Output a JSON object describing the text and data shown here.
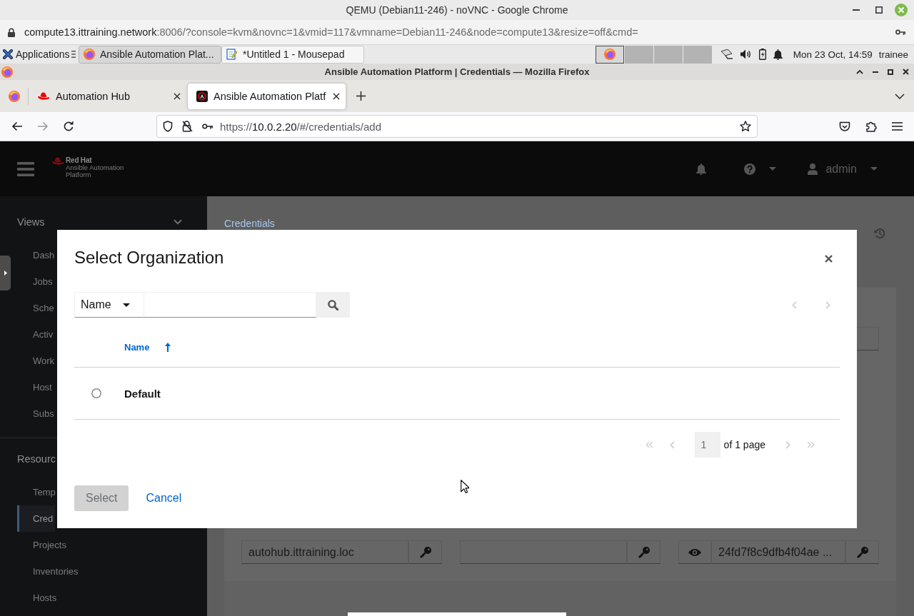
{
  "chrome": {
    "title": "QEMU (Debian11-246) - noVNC - Google Chrome",
    "url_host": "compute13.ittraining.network",
    "url_rest": ":8006/?console=kvm&novnc=1&vmid=117&vmname=Debian11-246&node=compute13&resize=off&cmd="
  },
  "panel": {
    "menu": "Applications",
    "tasks": [
      {
        "label": "Ansible Automation Plat...",
        "kind": "browser",
        "selected": true
      },
      {
        "label": "*Untitled 1 - Mousepad",
        "kind": "editor",
        "selected": false
      }
    ],
    "workspaces": [
      {
        "kind": "browser",
        "selected": true
      },
      {
        "kind": "empty",
        "selected": false
      },
      {
        "kind": "empty",
        "selected": false
      },
      {
        "kind": "empty",
        "selected": false
      }
    ],
    "clock": "Mon 23 Oct, 14:59",
    "user": "trainee"
  },
  "firefox": {
    "title": "Ansible Automation Platform | Credentials — Mozilla Firefox",
    "tabs": [
      {
        "label": "Automation Hub",
        "kind": "hub",
        "selected": false
      },
      {
        "label": "Ansible Automation Platf",
        "kind": "platform",
        "selected": true
      }
    ],
    "nav": [
      {
        "kind": "back",
        "disabled": false
      },
      {
        "kind": "forward",
        "disabled": true
      },
      {
        "kind": "reload",
        "disabled": false
      }
    ],
    "url": {
      "scheme": "https://",
      "host": "10.0.2.20",
      "path": "/#/credentials/add"
    }
  },
  "app": {
    "brand": {
      "line_1": "Red Hat",
      "line_2": "Ansible Automation",
      "line_3": "Platform"
    },
    "user": "admin"
  },
  "sidebar": {
    "sections": [
      {
        "title": "Views",
        "expanded": true,
        "items": [
          {
            "label": "Dash",
            "selected": false
          },
          {
            "label": "Jobs",
            "selected": false
          },
          {
            "label": "Sche",
            "selected": false
          },
          {
            "label": "Activ",
            "selected": false
          },
          {
            "label": "Work",
            "selected": false
          },
          {
            "label": "Host",
            "selected": false
          },
          {
            "label": "Subs",
            "selected": false
          }
        ]
      },
      {
        "title": "Resourc",
        "items": [
          {
            "label": "Temp",
            "selected": false
          },
          {
            "label": "Cred",
            "selected": true
          },
          {
            "label": "Projects",
            "selected": false
          },
          {
            "label": "Inventories",
            "selected": false
          },
          {
            "label": "Hosts",
            "selected": false
          }
        ]
      }
    ]
  },
  "page": {
    "breadcrumb": "Credentials",
    "upper_fields": [
      {
        "kind": "text"
      }
    ],
    "fields": [
      {
        "kind": "text",
        "value": "autohub.ittraining.loc"
      },
      {
        "kind": "text"
      },
      {
        "kind": "secret",
        "value": "24fd7f8c9dfb4f04ae ..."
      }
    ]
  },
  "modal": {
    "title": "Select Organization",
    "filter": "Name",
    "top_pager": [
      {
        "kind": "previous",
        "disabled": true
      },
      {
        "kind": "next",
        "disabled": true
      }
    ],
    "columns": [
      {
        "label": "Name",
        "ascending": true
      }
    ],
    "rows": [
      {
        "name": "Default",
        "selected": false
      }
    ],
    "pagination": {
      "page": "1",
      "total": "of 1 page",
      "controls": [
        {
          "kind": "first",
          "disabled": true
        },
        {
          "kind": "previous",
          "disabled": true
        },
        {
          "kind": "next",
          "disabled": true
        },
        {
          "kind": "last",
          "disabled": true
        }
      ]
    },
    "buttons": [
      {
        "label": "Select",
        "kind": "primary",
        "disabled": true
      },
      {
        "label": "Cancel",
        "kind": "link",
        "disabled": false
      }
    ]
  }
}
